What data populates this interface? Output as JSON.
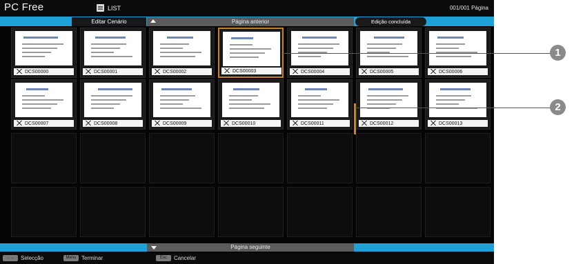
{
  "header": {
    "app_title": "PC Free",
    "list_label": "LIST",
    "page_indicator": "001/001 Página"
  },
  "toolbar": {
    "edit_tab": "Editar Cenário",
    "prev_page": "Página anterior",
    "done_label": "Edição concluída"
  },
  "slides": [
    {
      "name": "DCS00000"
    },
    {
      "name": "DCS00001"
    },
    {
      "name": "DCS00002"
    },
    {
      "name": "DCS00003",
      "selected": true
    },
    {
      "name": "DCS00004"
    },
    {
      "name": "DCS00005"
    },
    {
      "name": "DCS00006"
    },
    {
      "name": "DCS00007"
    },
    {
      "name": "DCS00008"
    },
    {
      "name": "DCS00009"
    },
    {
      "name": "DCS00010"
    },
    {
      "name": "DCS00011"
    },
    {
      "name": "DCS00012"
    },
    {
      "name": "DCS00013"
    }
  ],
  "empty_cells": 14,
  "next_page": "Página seguinte",
  "footer": {
    "select_key": "←→",
    "select_label": "Selecção",
    "finish_key": "Menu",
    "finish_label": "Terminar",
    "cancel_key": "Esc",
    "cancel_label": "Cancelar"
  },
  "callouts": {
    "one": "1",
    "two": "2"
  },
  "colors": {
    "accent": "#1ea1d6",
    "selection": "#c8821e",
    "background": "#050505"
  }
}
